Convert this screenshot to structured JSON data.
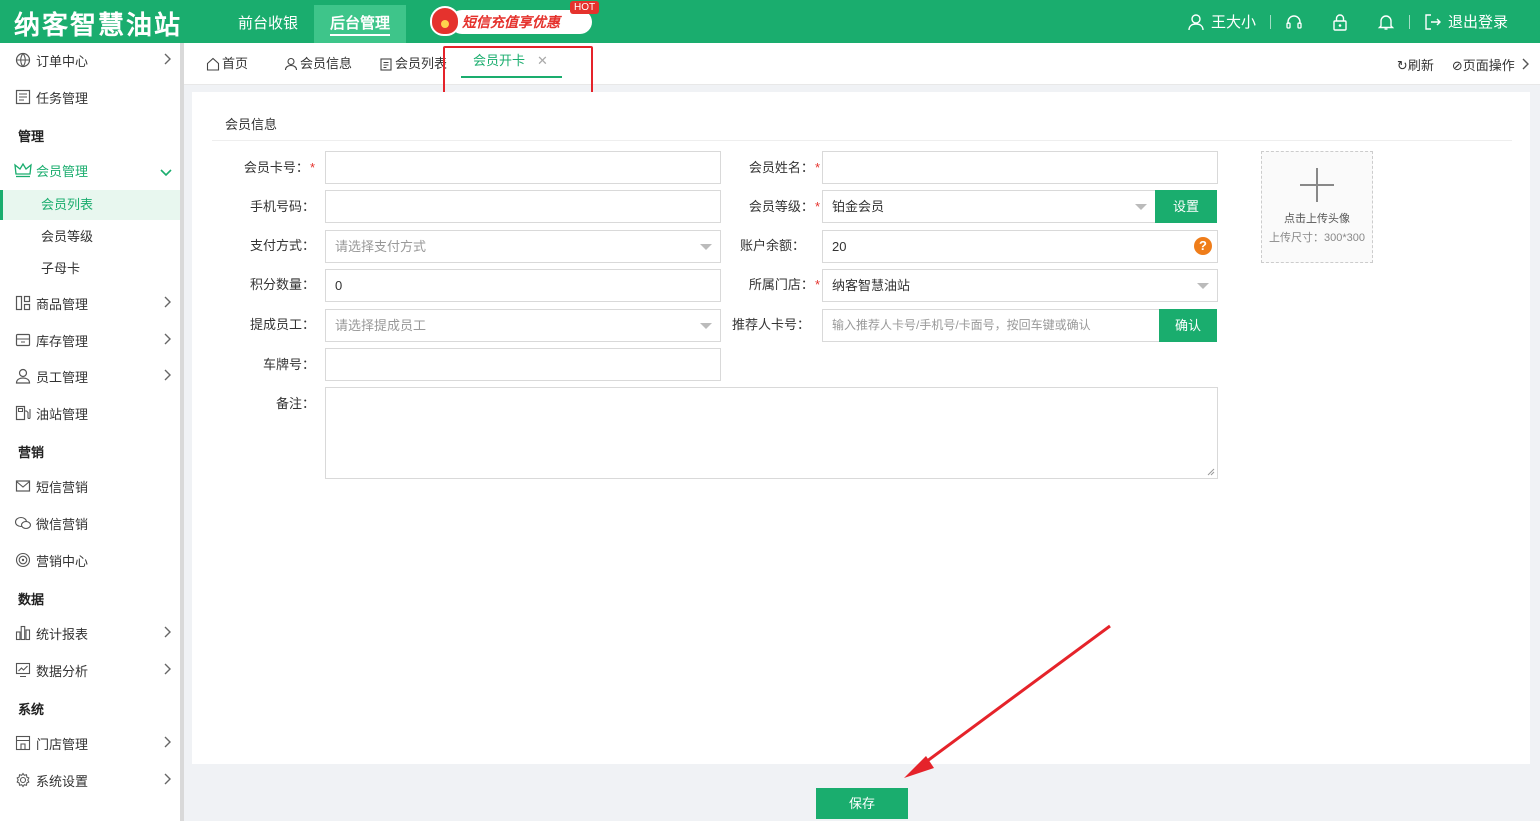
{
  "header": {
    "logo": "纳客智慧油站",
    "tabs": [
      {
        "label": "前台收银"
      },
      {
        "label": "后台管理"
      }
    ],
    "promo": {
      "label": "短信充值享优惠",
      "badge": "HOT"
    },
    "user": "王大小",
    "logout": "退出登录"
  },
  "sidebar": {
    "order": "订单中心",
    "task": "任务管理",
    "group_manage": "管理",
    "member": "会员管理",
    "member_list": "会员列表",
    "member_level": "会员等级",
    "sub_card": "子母卡",
    "goods": "商品管理",
    "stock": "库存管理",
    "staff": "员工管理",
    "station": "油站管理",
    "group_marketing": "营销",
    "sms": "短信营销",
    "wechat": "微信营销",
    "marketing_center": "营销中心",
    "group_data": "数据",
    "report": "统计报表",
    "analysis": "数据分析",
    "group_system": "系统",
    "store": "门店管理",
    "settings": "系统设置"
  },
  "page_tabs": {
    "home": "首页",
    "member_info": "会员信息",
    "member_list": "会员列表",
    "open_card": "会员开卡",
    "refresh": "刷新",
    "page_ops": "页面操作"
  },
  "form": {
    "section_title": "会员信息",
    "card_no_label": "会员卡号：",
    "name_label": "会员姓名：",
    "phone_label": "手机号码：",
    "level_label": "会员等级：",
    "level_value": "铂金会员",
    "level_button": "设置",
    "pay_label": "支付方式：",
    "pay_placeholder": "请选择支付方式",
    "balance_label": "账户余额：",
    "balance_value": "20",
    "points_label": "积分数量：",
    "points_value": "0",
    "store_label": "所属门店：",
    "store_value": "纳客智慧油站",
    "staff_label": "提成员工：",
    "staff_placeholder": "请选择提成员工",
    "referrer_label": "推荐人卡号：",
    "referrer_placeholder": "输入推荐人卡号/手机号/卡面号，按回车键或确认",
    "referrer_button": "确认",
    "plate_label": "车牌号：",
    "remark_label": "备注：",
    "upload_title": "点击上传头像",
    "upload_size": "上传尺寸：300*300",
    "save": "保存"
  },
  "colors": {
    "brand": "#1aad6e",
    "required": "#e5322d",
    "annotation": "#e5232a"
  }
}
